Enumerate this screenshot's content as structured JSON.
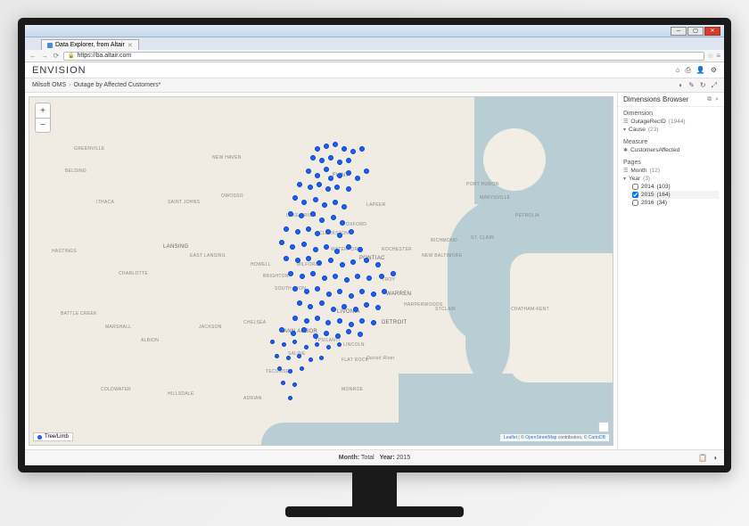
{
  "browser": {
    "tab_title": "Data Explorer, from Altair",
    "url": "https://ba.altair.com"
  },
  "app": {
    "logo": "ENVISION"
  },
  "crumb": {
    "root": "Milsoft OMS",
    "page": "Outage by Affected Customers*"
  },
  "side": {
    "title": "Dimensions Browser",
    "dimension_h": "Dimension",
    "dimension": "OutageRecID",
    "dimension_cnt": "(1944)",
    "cause": "Cause",
    "cause_cnt": "(23)",
    "measure_h": "Measure",
    "measure": "CustomersAffected",
    "pages_h": "Pages",
    "month": "Month",
    "month_cnt": "(12)",
    "year": "Year",
    "year_cnt": "(3)",
    "years": [
      {
        "label": "2014",
        "cnt": "(103)",
        "checked": false
      },
      {
        "label": "2015",
        "cnt": "(164)",
        "checked": true
      },
      {
        "label": "2016",
        "cnt": "(34)",
        "checked": false
      }
    ]
  },
  "legend": {
    "item": "Tree/Limb"
  },
  "attrib": {
    "leaflet": "Leaflet",
    "osm": "OpenStreetMap",
    "contrib": "contributors,",
    "carto": "CartoDB"
  },
  "footer": {
    "month_l": "Month:",
    "month_v": "Total",
    "year_l": "Year:",
    "year_v": "2015"
  },
  "cities": {
    "greenville": "GREENVILLE",
    "belding": "BELDING",
    "newhaven": "NEW HAVEN",
    "ithaca": "ITHACA",
    "stjohns": "SAINT JOHNS",
    "owosso": "OWOSSO",
    "flint": "FLINT",
    "porthuroni": "PORT HURON",
    "marysville": "MARYSVILLE",
    "lapeer": "LAPEER",
    "lakeorion": "LAKE ORION",
    "oxford": "OXFORD",
    "clarkston": "CLARKSTON",
    "hastings": "HASTINGS",
    "lansing": "LANSING",
    "eastlansing": "EAST LANSING",
    "howell": "HOWELL",
    "brighton": "BRIGHTON",
    "milford": "MILFORD",
    "southlyon": "SOUTH LYON",
    "waterford": "WATERFORD",
    "rochester": "ROCHESTER",
    "richmond": "RICHMOND",
    "stclair": "ST. CLAIR",
    "newbaltimore": "NEW BALTIMORE",
    "charlotte": "CHARLOTTE",
    "warren": "WARREN",
    "harperwoods": "HARPERWOODS",
    "stclairshores": "STCLAIR",
    "battlecreek": "BATTLE CREEK",
    "marshall": "MARSHALL",
    "albion": "ALBION",
    "jackson": "JACKSON",
    "chelsea": "CHELSEA",
    "annarbor": "ANN ARBOR",
    "ypsilanti": "YPSILANTI",
    "detroit": "DETROIT",
    "lincolnpark": "LINCOLN",
    "flatrock": "FLAT ROCK",
    "chathamkent": "CHATHAM-KENT",
    "petrolia": "PETROLIA",
    "saline": "SALINE",
    "tecumseh": "TECUMSEH",
    "coldwater": "COLDWATER",
    "hillsdale": "HILLSDALE",
    "adrian": "ADRIAN",
    "monroe": "MONROE",
    "detroitriver": "Detroit River",
    "livonia": "LIVONIA",
    "troy": "TROY",
    "pontiac": "PONTIAC"
  }
}
